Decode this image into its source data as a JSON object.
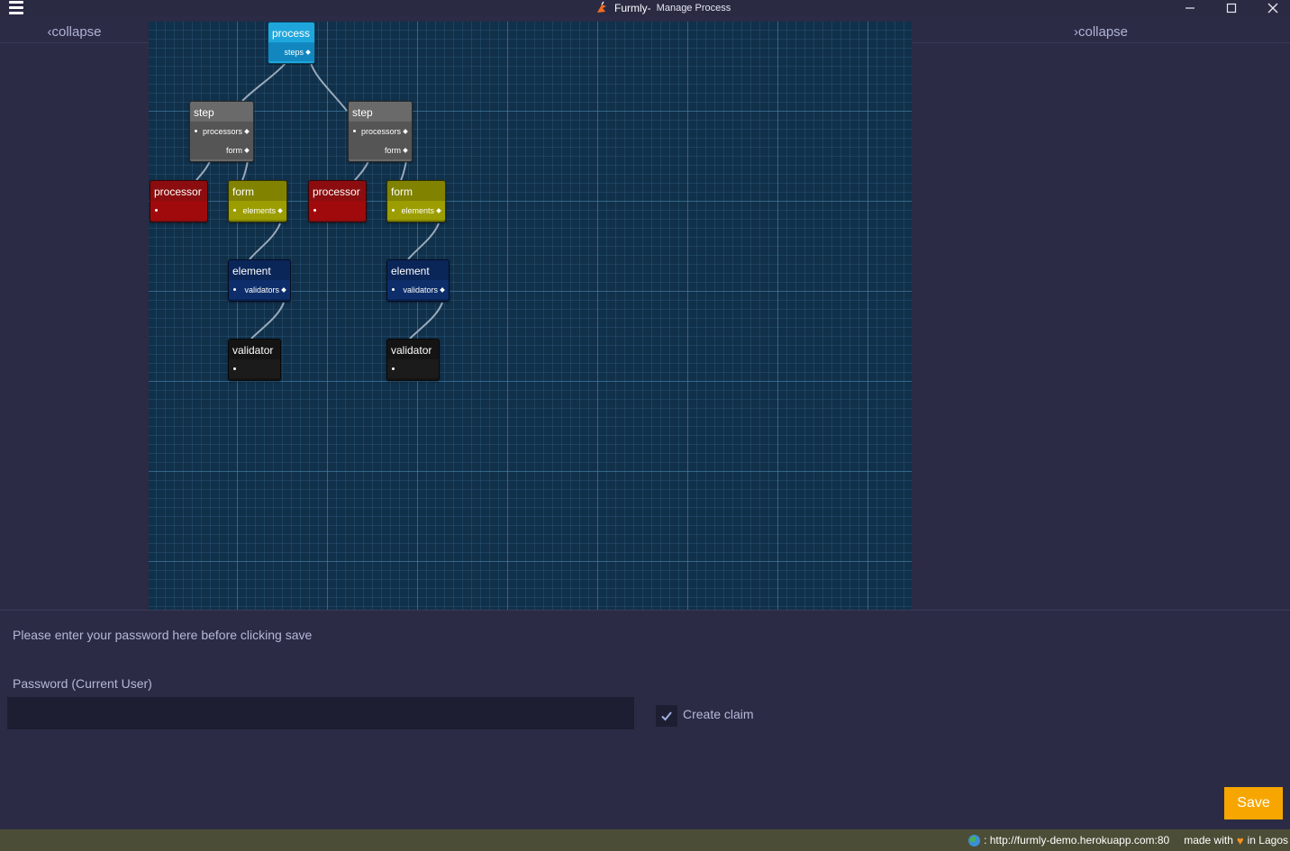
{
  "window": {
    "title_app": "Furmly-",
    "title_page": " Manage Process",
    "minimize": "—",
    "close": "✕"
  },
  "left_panel": {
    "collapse_label": "‹collapse"
  },
  "right_panel": {
    "collapse_label": "›collapse"
  },
  "canvas": {
    "nodes": {
      "process": {
        "title": "process",
        "port": "steps"
      },
      "step1": {
        "title": "step",
        "port1": "processors",
        "port2": "form"
      },
      "step2": {
        "title": "step",
        "port1": "processors",
        "port2": "form"
      },
      "processor1": {
        "title": "processor"
      },
      "processor2": {
        "title": "processor"
      },
      "form1": {
        "title": "form",
        "port": "elements"
      },
      "form2": {
        "title": "form",
        "port": "elements"
      },
      "element1": {
        "title": "element",
        "port": "validators"
      },
      "element2": {
        "title": "element",
        "port": "validators"
      },
      "validator1": {
        "title": "validator"
      },
      "validator2": {
        "title": "validator"
      }
    }
  },
  "form": {
    "hint": "Please enter your password here before clicking save",
    "password_label": "Password (Current User)",
    "password_value": "",
    "create_claim_label": "Create claim",
    "create_claim_checked": true,
    "save_label": "Save"
  },
  "footer": {
    "url": ": http://furmly-demo.herokuapp.com:80",
    "made_with": "made with",
    "in_lagos": "in Lagos"
  },
  "colors": {
    "accent_save": "#f7a600",
    "canvas_bg": "#11304a",
    "process_node": "#1ea6dc",
    "step_node": "#6a6a6a",
    "processor_node": "#8b0d0f",
    "form_node": "#818300",
    "element_node": "#0a2558",
    "validator_node": "#141414",
    "footer_bg": "#4c4d36"
  }
}
